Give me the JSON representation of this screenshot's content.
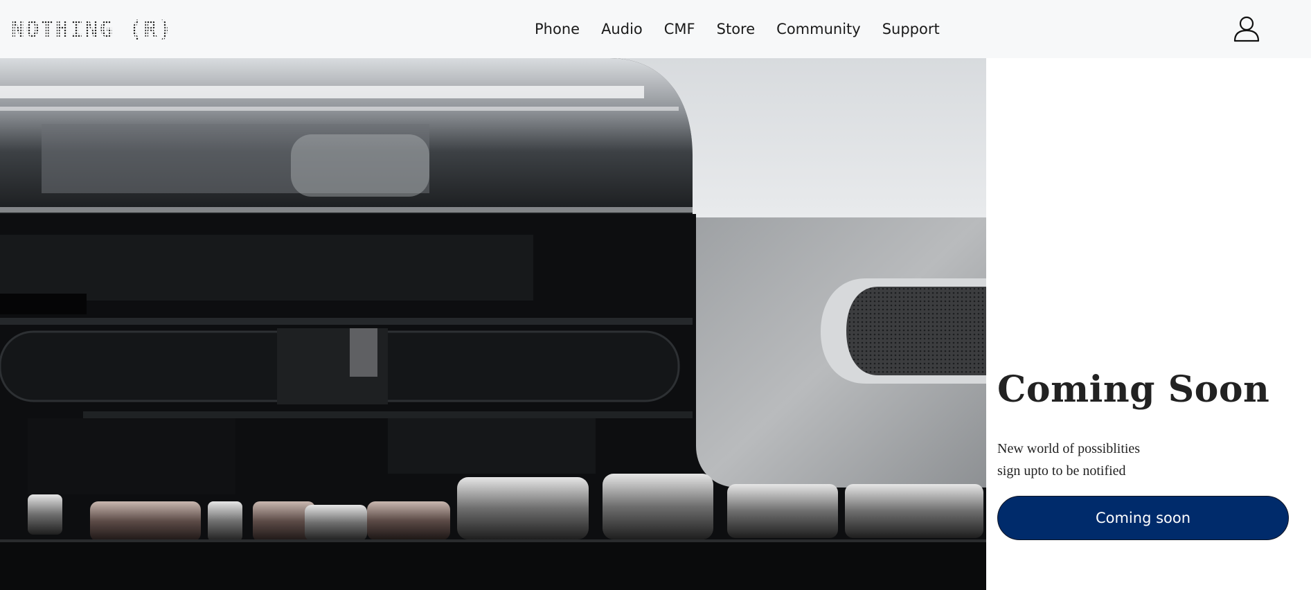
{
  "header": {
    "logo_text": "NOTHING (R)",
    "nav": [
      "Phone",
      "Audio",
      "CMF",
      "Store",
      "Community",
      "Support"
    ],
    "user_icon": "user-icon"
  },
  "hero": {
    "image": "product-closeup-earbuds-case"
  },
  "promo": {
    "title": "Coming Soon",
    "line1": "New world of possiblities",
    "line2": "sign upto to be notified",
    "button_label": "Coming soon"
  },
  "colors": {
    "header_bg": "#f7f8f9",
    "button_bg": "#002b6b",
    "text": "#222222"
  }
}
